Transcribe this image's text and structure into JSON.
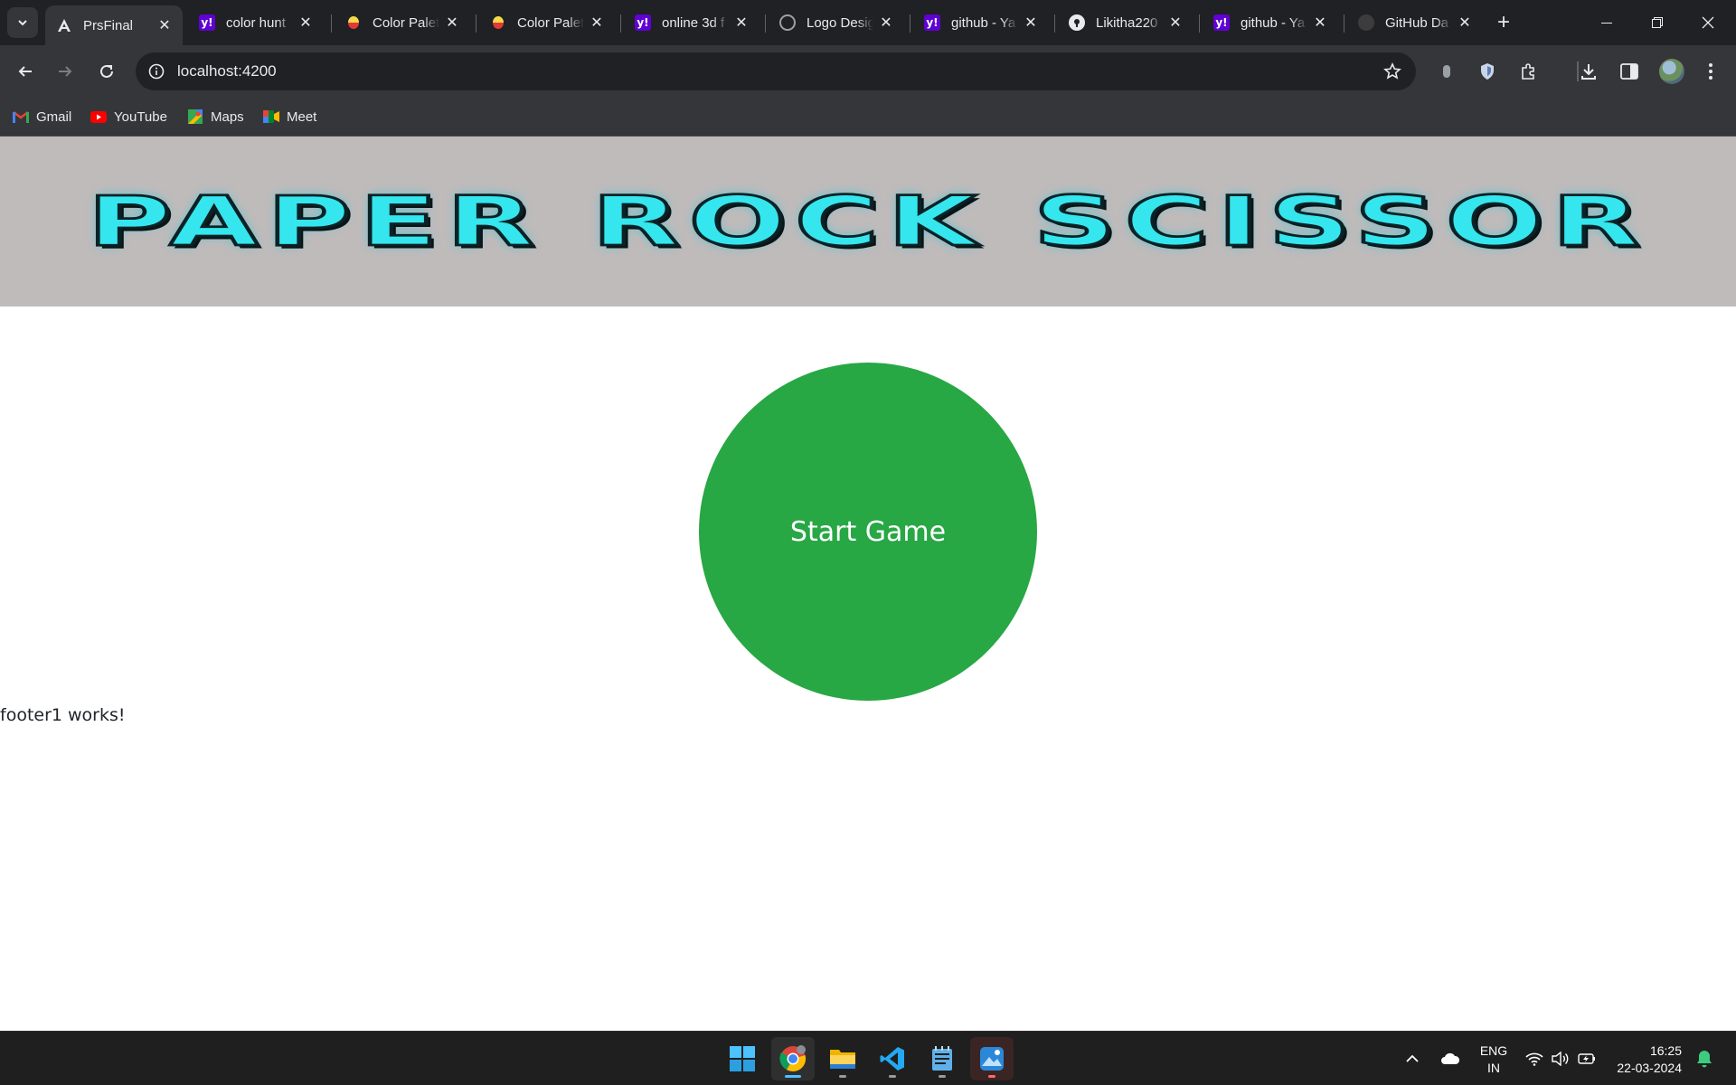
{
  "browser": {
    "tabs": [
      {
        "title": "PrsFinal",
        "icon": "angular-icon",
        "active": true
      },
      {
        "title": "color hunt",
        "icon": "yahoo-icon"
      },
      {
        "title": "Color Palett",
        "icon": "color-palette-icon"
      },
      {
        "title": "Color Palett",
        "icon": "color-palette-icon"
      },
      {
        "title": "online 3d f",
        "icon": "yahoo-icon"
      },
      {
        "title": "Logo Desig",
        "icon": "globe-icon"
      },
      {
        "title": "github - Ya",
        "icon": "yahoo-icon"
      },
      {
        "title": "Likitha220",
        "icon": "github-icon"
      },
      {
        "title": "github - Ya",
        "icon": "yahoo-icon"
      },
      {
        "title": "GitHub Da",
        "icon": "github-icon"
      }
    ],
    "url": "localhost:4200",
    "bookmarks": [
      {
        "label": "Gmail",
        "icon": "gmail-icon"
      },
      {
        "label": "YouTube",
        "icon": "youtube-icon"
      },
      {
        "label": "Maps",
        "icon": "maps-icon"
      },
      {
        "label": "Meet",
        "icon": "meet-icon"
      }
    ]
  },
  "page": {
    "header_title": "PAPER ROCK SCISSOR",
    "start_button_label": "Start Game",
    "footer_text": "footer1 works!",
    "colors": {
      "header_bg": "#c0bbbb",
      "title_color": "#35e6ee",
      "start_button_bg": "#28a745"
    }
  },
  "taskbar": {
    "apps": [
      "windows-start-icon",
      "chrome-icon",
      "file-explorer-icon",
      "vscode-icon",
      "notepad-icon",
      "photos-icon"
    ],
    "language": {
      "line1": "ENG",
      "line2": "IN"
    },
    "time": "16:25",
    "date": "22-03-2024"
  }
}
